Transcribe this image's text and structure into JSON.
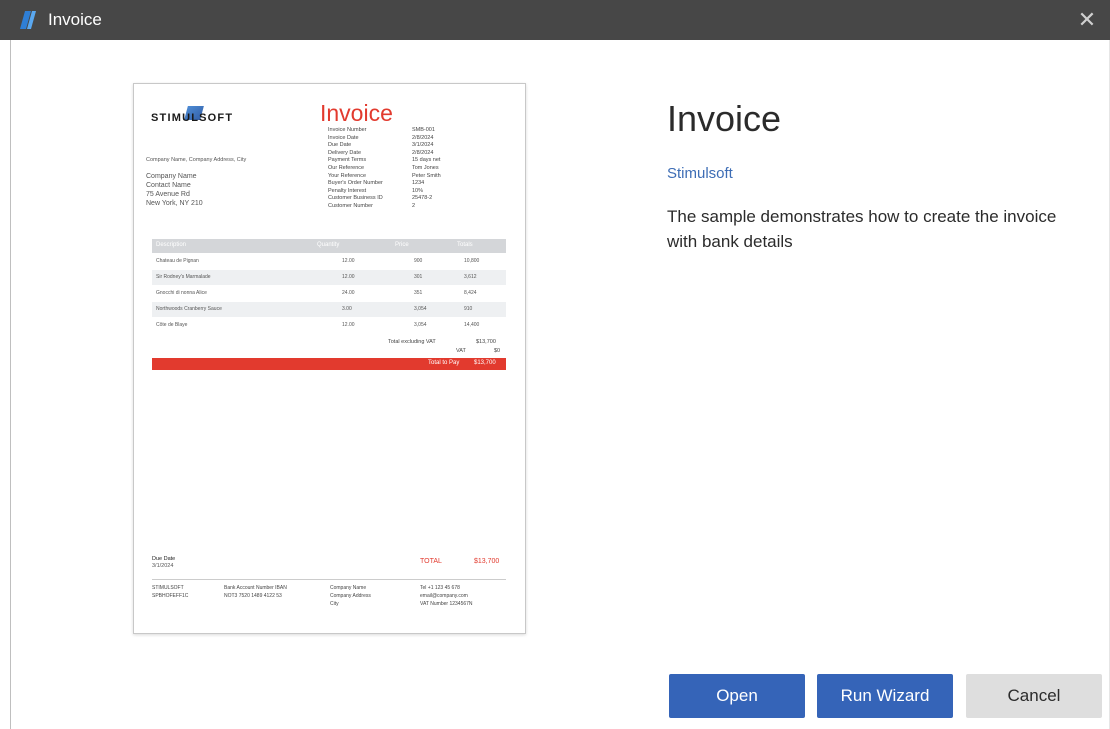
{
  "window": {
    "title": "Invoice",
    "close_glyph": "✕"
  },
  "preview": {
    "logo": "STIMULSOFT",
    "title": "Invoice",
    "meta": [
      {
        "key": "Invoice Number",
        "value": "SMB-001"
      },
      {
        "key": "Invoice Date",
        "value": "2/8/2024"
      },
      {
        "key": "Due Date",
        "value": "3/1/2024"
      },
      {
        "key": "Delivery Date",
        "value": "2/8/2024"
      },
      {
        "key": "Payment Terms",
        "value": "15 days net"
      },
      {
        "key": "Our Reference",
        "value": "Tom Jones"
      },
      {
        "key": "Your Reference",
        "value": "Peter Smith"
      },
      {
        "key": "Buyer's Order Number",
        "value": "1234"
      },
      {
        "key": "Penalty Interest",
        "value": "10%"
      },
      {
        "key": "Customer Business ID",
        "value": "25478-2"
      },
      {
        "key": "Customer Number",
        "value": "2"
      }
    ],
    "company_line": "Company Name, Company Address, City",
    "address": [
      "Company Name",
      "Contact Name",
      "75 Avenue Rd",
      "New York, NY 210"
    ],
    "table_headers": [
      "Description",
      "Quantity",
      "Price",
      "Totals"
    ],
    "rows": [
      [
        "Chateau de Pignan",
        "12.00",
        "900",
        "10,800"
      ],
      [
        "Sir Rodney's Marmalade",
        "12.00",
        "301",
        "3,612"
      ],
      [
        "Gnocchi di nonna Alice",
        "24.00",
        "351",
        "8,424"
      ],
      [
        "Northwoods Cranberry Sauce",
        "3.00",
        "3,054",
        "910"
      ],
      [
        "Côte de Blaye",
        "12.00",
        "3,054",
        "14,400"
      ]
    ],
    "subtotal_label": "Total excluding VAT",
    "subtotal_value": "$13,700",
    "vat_label": "VAT",
    "vat_value": "$0",
    "total_label": "Total to Pay",
    "total_value": "$13,700",
    "due_label": "Due Date",
    "due_value": "3/1/2024",
    "footer_total_label": "TOTAL",
    "footer_total_value": "$13,700",
    "footer": [
      [
        "STIMULSOFT",
        "SPBHOFEFF1C"
      ],
      [
        "Bank Account Number IBAN",
        "NOT3 7520 1489 4122 53"
      ],
      [
        "Company Name",
        "Company Address",
        "City"
      ],
      [
        "Tel +1 123 45 678",
        "email@company.com",
        "VAT Number 1234567N"
      ]
    ]
  },
  "info": {
    "heading": "Invoice",
    "author": "Stimulsoft",
    "description": "The sample demonstrates how to create the invoice with bank details"
  },
  "buttons": {
    "open": "Open",
    "wizard": "Run Wizard",
    "cancel": "Cancel"
  },
  "colors": {
    "titlebar": "#474747",
    "accent": "#3564b8",
    "invoice_red": "#e23a2e"
  }
}
